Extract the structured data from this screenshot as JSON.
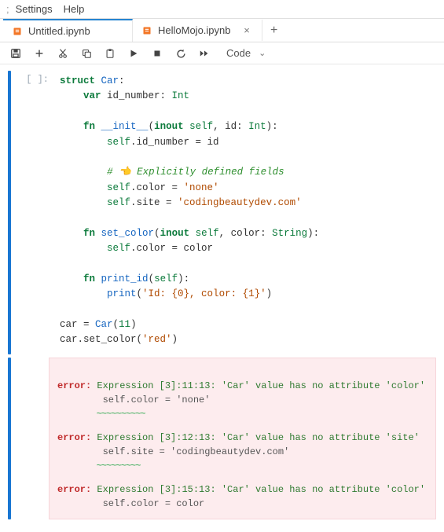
{
  "menubar": {
    "ellipsis": ";",
    "items": [
      "Settings",
      "Help"
    ]
  },
  "tabs": [
    {
      "label": "Untitled.ipynb",
      "dirty": true,
      "active": true
    },
    {
      "label": "HelloMojo.ipynb",
      "dirty": false,
      "active": false,
      "close_glyph": "×"
    }
  ],
  "newtab_glyph": "+",
  "toolbar": {
    "celltype": "Code",
    "chevron": "⌄"
  },
  "cell": {
    "prompt": "[ ]:",
    "code": {
      "l1": {
        "a": "struct",
        "b": " ",
        "c": "Car",
        "d": ":"
      },
      "l2": {
        "a": "    ",
        "b": "var",
        "c": " id_number: ",
        "d": "Int"
      },
      "l3": "",
      "l4": {
        "a": "    ",
        "b": "fn",
        "c": " ",
        "d": "__init__",
        "e": "(",
        "f": "inout",
        "g": " ",
        "h": "self",
        "i": ", id: ",
        "j": "Int",
        "k": "):"
      },
      "l5": {
        "a": "        ",
        "b": "self",
        "c": ".id_number = id"
      },
      "l6": "",
      "l7": {
        "a": "        ",
        "b": "# 👈 Explicitly defined fields"
      },
      "l8": {
        "a": "        ",
        "b": "self",
        "c": ".color = ",
        "d": "'none'"
      },
      "l9": {
        "a": "        ",
        "b": "self",
        "c": ".site = ",
        "d": "'codingbeautydev.com'"
      },
      "l10": "",
      "l11": {
        "a": "    ",
        "b": "fn",
        "c": " ",
        "d": "set_color",
        "e": "(",
        "f": "inout",
        "g": " ",
        "h": "self",
        "i": ", color: ",
        "j": "String",
        "k": "):"
      },
      "l12": {
        "a": "        ",
        "b": "self",
        "c": ".color = color"
      },
      "l13": "",
      "l14": {
        "a": "    ",
        "b": "fn",
        "c": " ",
        "d": "print_id",
        "e": "(",
        "f": "self",
        "g": "):"
      },
      "l15": {
        "a": "        ",
        "b": "print",
        "c": "(",
        "d": "'Id: {0}, color: {1}'",
        "e": ")"
      },
      "l16": "",
      "l17": {
        "a": "car = ",
        "b": "Car",
        "c": "(",
        "d": "11",
        "e": ")"
      },
      "l18": {
        "a": "car.set_color(",
        "b": "'red'",
        "c": ")"
      }
    }
  },
  "errors": [
    {
      "label": "error:",
      "msg": " Expression [3]:11:13: 'Car' value has no attribute 'color'",
      "line": "        self.color = 'none'",
      "wave": "        ~~~~~~~~~~"
    },
    {
      "label": "error:",
      "msg": " Expression [3]:12:13: 'Car' value has no attribute 'site'",
      "line": "        self.site = 'codingbeautydev.com'",
      "wave": "        ~~~~~~~~~"
    },
    {
      "label": "error:",
      "msg": " Expression [3]:15:13: 'Car' value has no attribute 'color'",
      "line": "        self.color = color",
      "wave": ""
    }
  ]
}
